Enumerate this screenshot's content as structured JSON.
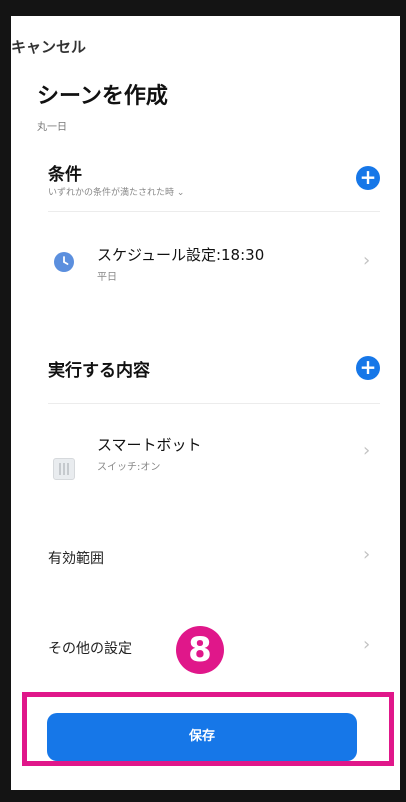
{
  "header": {
    "cancel_label": "キャンセル",
    "title": "シーンを作成",
    "subtitle": "丸一日"
  },
  "conditions": {
    "title": "条件",
    "hint": "いずれかの条件が満たされた時 ⌄",
    "items": [
      {
        "label": "スケジュール設定:18:30",
        "sub": "平日",
        "icon": "clock-icon"
      }
    ]
  },
  "actions": {
    "title": "実行する内容",
    "items": [
      {
        "label": "スマートボット",
        "sub": "スイッチ:オン",
        "icon": "smartbot-device-icon"
      }
    ]
  },
  "settings": {
    "scope_label": "有効範囲",
    "other_label": "その他の設定"
  },
  "annotation": {
    "step_number": "8"
  },
  "footer": {
    "save_label": "保存"
  },
  "colors": {
    "accent": "#1677e8",
    "highlight": "#e0178a",
    "clock_icon": "#5b8fde"
  }
}
